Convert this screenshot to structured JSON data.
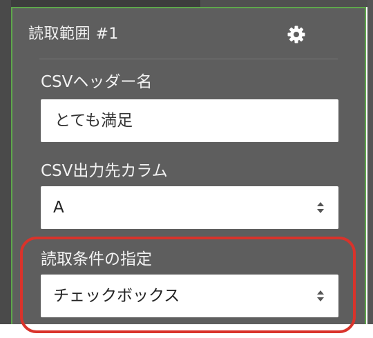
{
  "panel": {
    "title": "読取範囲 #1",
    "settings_icon": "gear-icon",
    "accent_color": "#5ea74b"
  },
  "fields": {
    "header_name": {
      "label": "CSVヘッダー名",
      "value": "とても満足"
    },
    "output_column": {
      "label": "CSV出力先カラム",
      "selected": "A"
    },
    "read_condition": {
      "label": "読取条件の指定",
      "selected": "チェックボックス"
    }
  },
  "highlight_color": "#d9332b"
}
